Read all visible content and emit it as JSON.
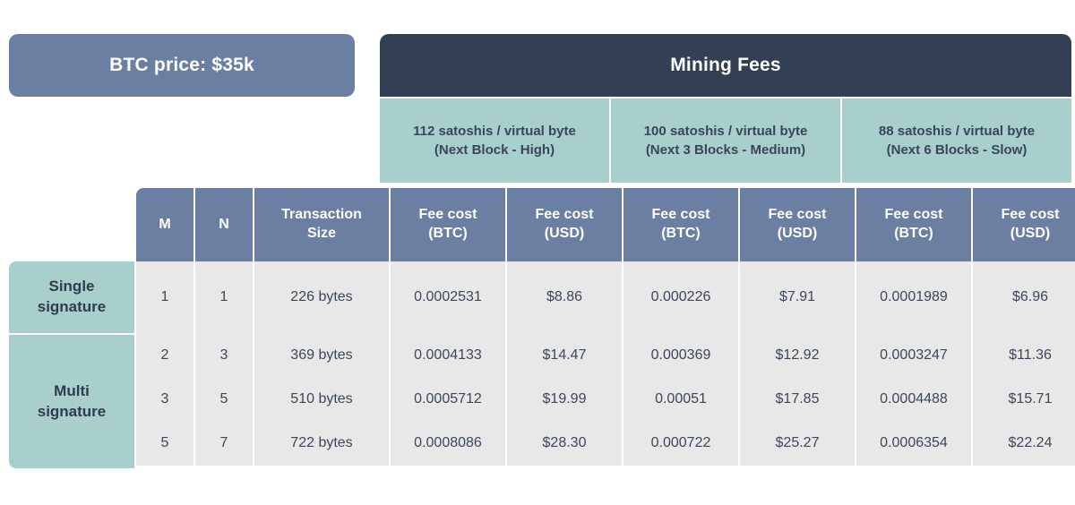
{
  "header": {
    "btc_price_label": "BTC price: $35k",
    "mining_fees_label": "Mining Fees"
  },
  "fee_rates": [
    {
      "rate": "112 satoshis / virtual byte",
      "speed": "(Next Block - High)"
    },
    {
      "rate": "100 satoshis / virtual byte",
      "speed": "(Next 3 Blocks - Medium)"
    },
    {
      "rate": "88 satoshis / virtual byte",
      "speed": "(Next 6 Blocks - Slow)"
    }
  ],
  "columns": {
    "m": "M",
    "n": "N",
    "tx_size_line1": "Transaction",
    "tx_size_line2": "Size",
    "fee_btc_line1": "Fee cost",
    "fee_btc_line2": "(BTC)",
    "fee_usd_line1": "Fee cost",
    "fee_usd_line2": "(USD)"
  },
  "categories": {
    "single_line1": "Single",
    "single_line2": "signature",
    "multi_line1": "Multi",
    "multi_line2": "signature"
  },
  "rows": [
    {
      "category": "Single signature",
      "m": "1",
      "n": "1",
      "tx_size": "226 bytes",
      "high_btc": "0.0002531",
      "high_usd": "$8.86",
      "medium_btc": "0.000226",
      "medium_usd": "$7.91",
      "slow_btc": "0.0001989",
      "slow_usd": "$6.96"
    },
    {
      "category": "Multi signature",
      "m": "2",
      "n": "3",
      "tx_size": "369 bytes",
      "high_btc": "0.0004133",
      "high_usd": "$14.47",
      "medium_btc": "0.000369",
      "medium_usd": "$12.92",
      "slow_btc": "0.0003247",
      "slow_usd": "$11.36"
    },
    {
      "category": "Multi signature",
      "m": "3",
      "n": "5",
      "tx_size": "510 bytes",
      "high_btc": "0.0005712",
      "high_usd": "$19.99",
      "medium_btc": "0.00051",
      "medium_usd": "$17.85",
      "slow_btc": "0.0004488",
      "slow_usd": "$15.71"
    },
    {
      "category": "Multi signature",
      "m": "5",
      "n": "7",
      "tx_size": "722 bytes",
      "high_btc": "0.0008086",
      "high_usd": "$28.30",
      "medium_btc": "0.000722",
      "medium_usd": "$25.27",
      "slow_btc": "0.0006354",
      "slow_usd": "$22.24"
    }
  ],
  "colors": {
    "slate": "#6b7fa3",
    "navy": "#333f52",
    "teal": "#a9cfcd",
    "cell_grey": "#e9e8e8",
    "text_dark": "#3b4759",
    "white": "#ffffff"
  }
}
